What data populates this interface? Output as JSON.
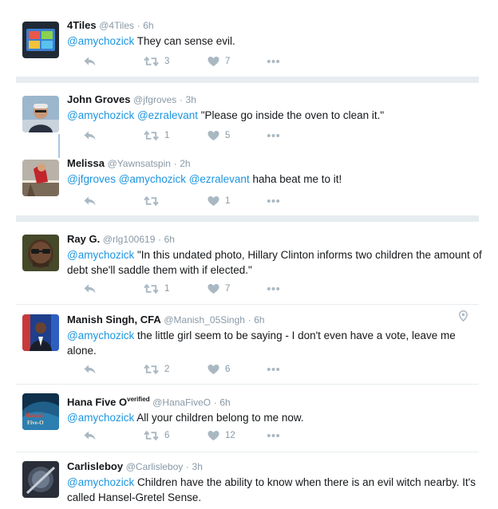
{
  "tweets": [
    {
      "name": "4Tiles",
      "handle": "@4Tiles",
      "time": "6h",
      "mentions": "@amychozick",
      "text": " They can sense evil.",
      "retweets": "3",
      "likes": "7"
    },
    {
      "name": "John Groves",
      "handle": "@jfgroves",
      "time": "3h",
      "mentions": "@amychozick @ezralevant",
      "text": " \"Please go inside the oven to clean it.\"",
      "retweets": "1",
      "likes": "5"
    },
    {
      "name": "Melissa",
      "handle": "@Yawnsatspin",
      "time": "2h",
      "mentions": "@jfgroves @amychozick @ezralevant",
      "text": " haha beat me to it!",
      "retweets": "",
      "likes": "1"
    },
    {
      "name": "Ray G.",
      "handle": "@rlg100619",
      "time": "6h",
      "mentions": "@amychozick",
      "text": " \"In this undated photo, Hillary Clinton informs two children the amount of debt she'll saddle them with if elected.\"",
      "retweets": "1",
      "likes": "7"
    },
    {
      "name": "Manish Singh, CFA",
      "handle": "@Manish_05Singh",
      "time": "6h",
      "mentions": "@amychozick",
      "text": " the little girl seem to be saying - I don't even have a vote, leave me alone.",
      "retweets": "2",
      "likes": "6"
    },
    {
      "name": "Hana Five O",
      "name_sup": "verified",
      "handle": "@HanaFiveO",
      "time": "6h",
      "mentions": "@amychozick",
      "text": " All your children belong to me now.",
      "retweets": "6",
      "likes": "12"
    },
    {
      "name": "Carlisleboy",
      "handle": "@Carlisleboy",
      "time": "3h",
      "mentions": "@amychozick",
      "text": " Children have the ability to know when there is an evil witch nearby. It's called Hansel-Gretel Sense."
    }
  ],
  "avatar_texts": {
    "hawaii": "Hawaii",
    "fiveo": "Five-O"
  },
  "icons": [
    "reply-icon",
    "retweet-icon",
    "like-icon",
    "more-icon",
    "location-pin-icon"
  ],
  "colors": {
    "link": "#1b95e0",
    "meta": "#8899a6",
    "icon": "#aab8c2",
    "divider": "#e6ecf0"
  }
}
